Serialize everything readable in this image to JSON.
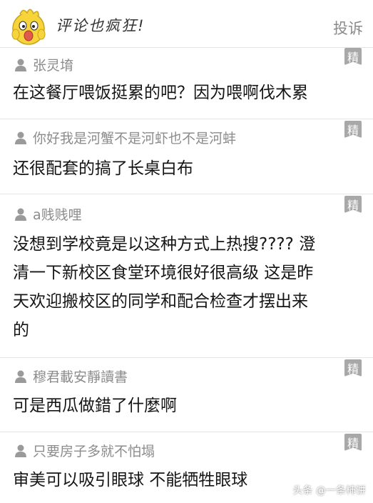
{
  "header": {
    "title": "评论也疯狂!",
    "report_label": "投诉"
  },
  "badge_label": "精",
  "comments": [
    {
      "username": "张灵堉",
      "lines": [
        "在这餐厅喂饭挺累的吧？因为喂啊伐木累"
      ]
    },
    {
      "username": "你好我是河蟹不是河虾也不是河蚌",
      "lines": [
        "还很配套的搞了长桌白布"
      ]
    },
    {
      "username": "a贱贱哩",
      "lines": [
        "没想到学校竟是以这种方式上热搜???? 澄",
        "清一下新校区食堂环境很好很高级 这是昨",
        "天欢迎搬校区的同学和配合检查才摆出来",
        "的"
      ]
    },
    {
      "username": "穆君載安靜讀書",
      "lines": [
        "可是西瓜做錯了什麼啊"
      ]
    },
    {
      "username": "只要房子多就不怕塌",
      "lines": [
        "审美可以吸引眼球 不能牺牲眼球"
      ]
    }
  ],
  "watermark": "头条 @一条柿饼",
  "colors": {
    "badge": "#a8a8a8",
    "username": "#8c8c8c",
    "mascot_yellow": "#f7d53a"
  }
}
